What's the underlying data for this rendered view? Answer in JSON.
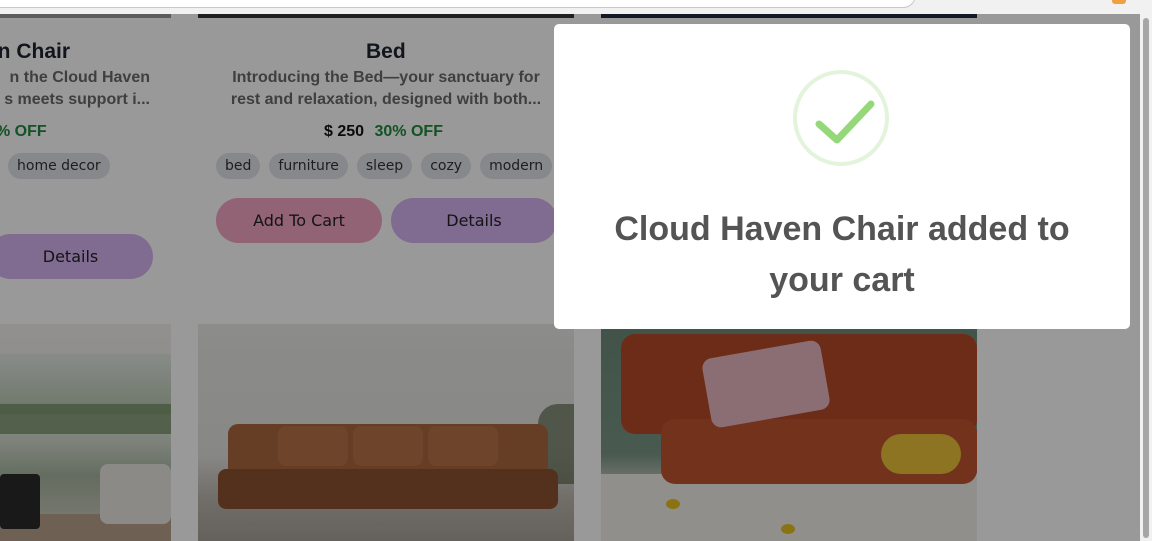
{
  "cards": [
    {
      "title": "en Chair",
      "description_line1": "n the Cloud Haven",
      "description_line2": "s meets support i...",
      "discount": "% OFF",
      "tags": [
        "home decor"
      ],
      "details_label": "Details"
    },
    {
      "title": "Bed",
      "description_line1": "Introducing the Bed—your sanctuary for",
      "description_line2": "rest and relaxation, designed with both...",
      "price": "$ 250",
      "discount": "30% OFF",
      "tags": [
        "bed",
        "furniture",
        "sleep",
        "cozy",
        "modern"
      ],
      "add_to_cart_label": "Add To Cart",
      "details_label": "Details"
    }
  ],
  "modal": {
    "message": "Cloud Haven Chair added to your cart",
    "icon": "success-check-icon",
    "check_color": "#95d87a",
    "ring_color": "#e4f3dc"
  },
  "colors": {
    "add_to_cart": "#f4a3c4",
    "details": "#d6b3f2",
    "discount": "#1f8a3b",
    "tag_bg": "#dfe3e8"
  }
}
